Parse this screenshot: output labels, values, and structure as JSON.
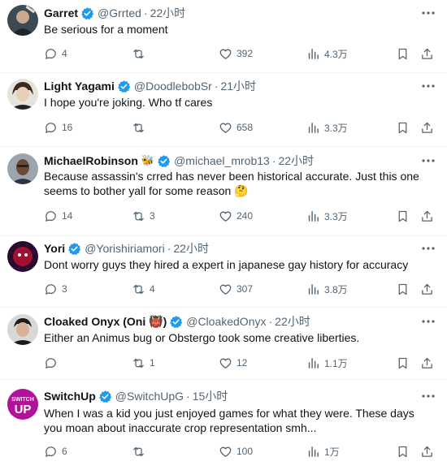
{
  "colors": {
    "verified": "#1d9bf0",
    "text": "#0f1419",
    "muted": "#536471",
    "divider": "#eff3f4"
  },
  "tweets": [
    {
      "name": "Garret",
      "handle": "@Grrted",
      "time": "22小时",
      "text": "Be serious for a moment",
      "replies": "4",
      "retweets": "",
      "likes": "392",
      "views": "4.3万"
    },
    {
      "name": "Light Yagami",
      "handle": "@DoodlebobSr",
      "time": "21小时",
      "text": "I hope you're joking. Who tf cares",
      "replies": "16",
      "retweets": "",
      "likes": "658",
      "views": "3.3万"
    },
    {
      "name": "MichaelRobinson",
      "emoji": "🐝",
      "handle": "@michael_mrob13",
      "time": "22小时",
      "text": "Because assassin's crred has never been historical accurate. Just this one seems to bother yall for some reason 🤔",
      "replies": "14",
      "retweets": "3",
      "likes": "240",
      "views": "3.3万"
    },
    {
      "name": "Yori",
      "handle": "@Yorishiriamori",
      "time": "22小时",
      "text": "Dont worry guys they hired a expert in japanese gay history for accuracy",
      "replies": "3",
      "retweets": "4",
      "likes": "307",
      "views": "3.8万"
    },
    {
      "name": "Cloaked Onyx (Oni 👹)",
      "handle": "@CloakedOnyx",
      "time": "22小时",
      "text": "Either an Animus bug or Obstergo took some creative liberties.",
      "replies": "",
      "retweets": "1",
      "likes": "12",
      "views": "1.1万"
    },
    {
      "name": "SwitchUp",
      "handle": "@SwitchUpG",
      "time": "15小时",
      "text": "When I was a kid you just enjoyed games for what they were. These days you moan about inaccurate crop representation smh...",
      "replies": "6",
      "retweets": "",
      "likes": "100",
      "views": "1万",
      "avatar_text": [
        "SWITCH",
        "UP"
      ]
    }
  ]
}
